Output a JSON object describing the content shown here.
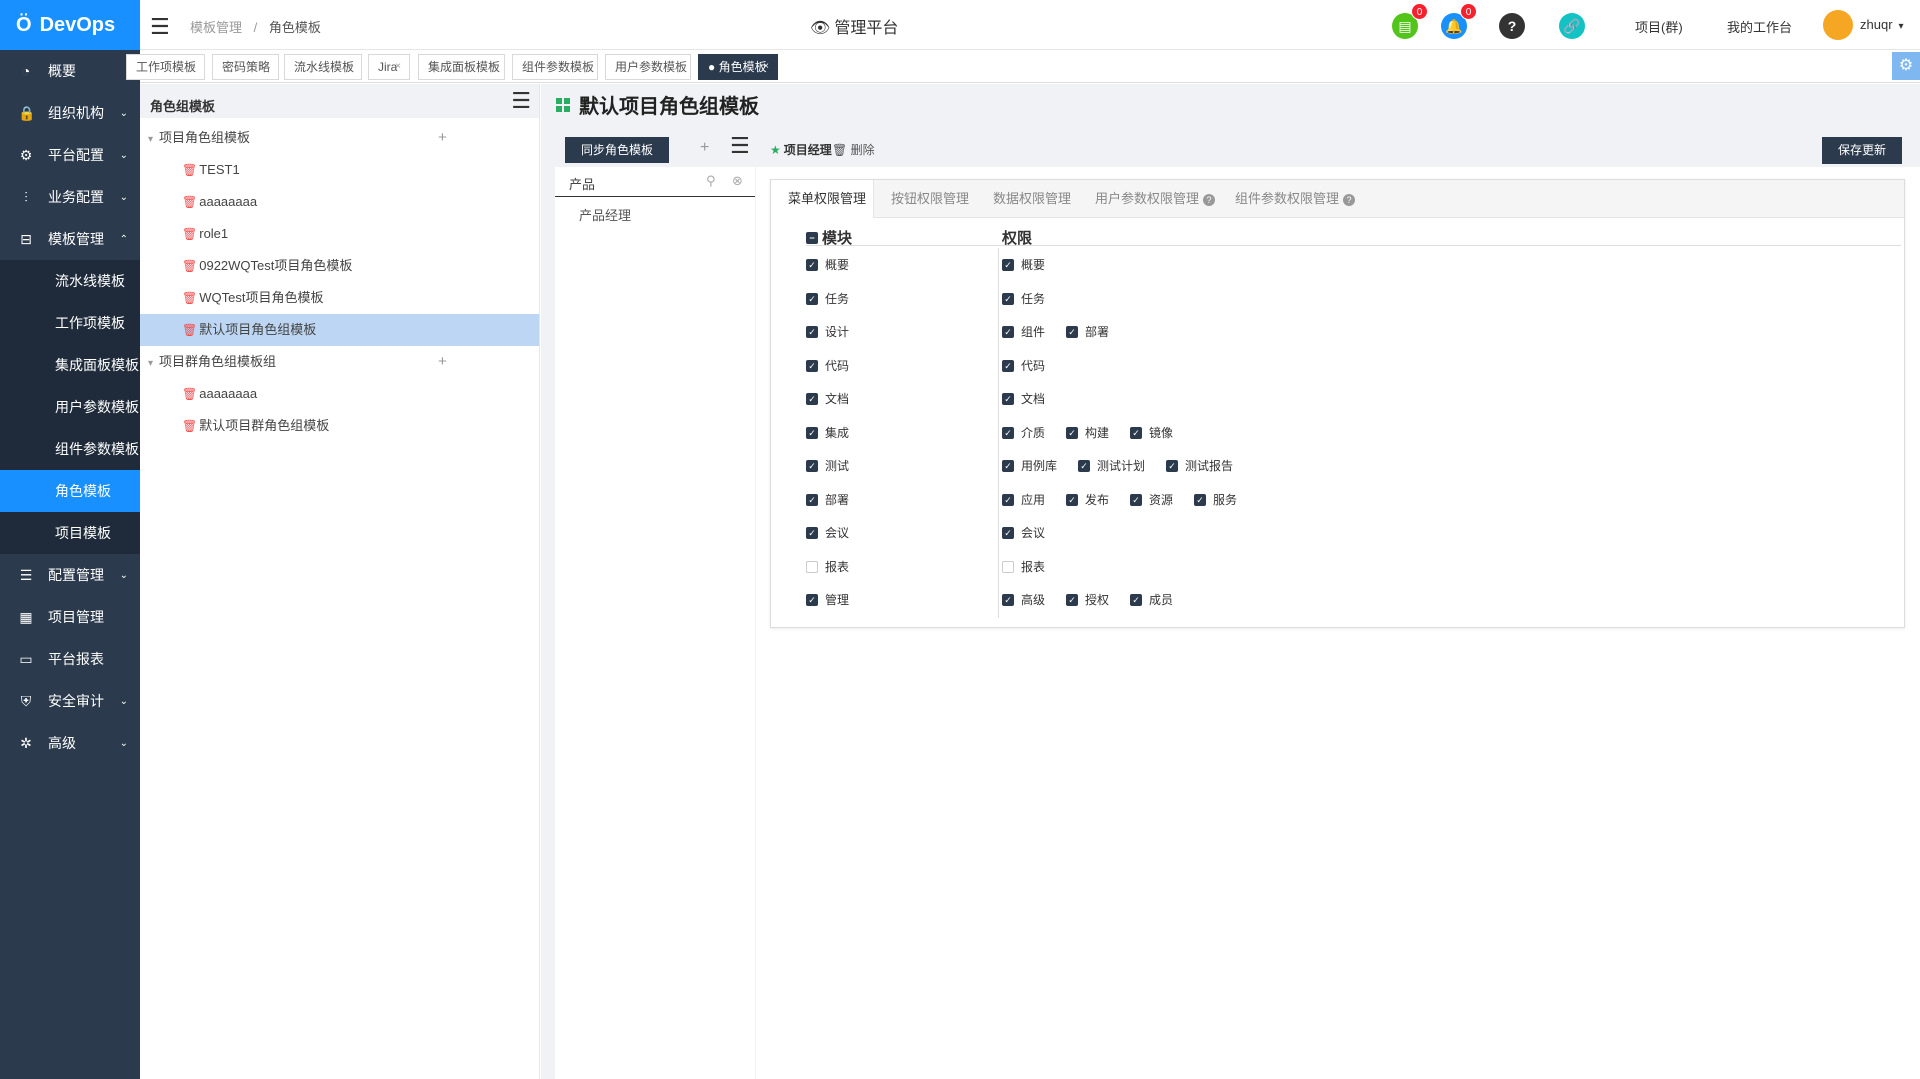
{
  "app": {
    "logo_text": "DevOps",
    "brand_color": "#1890ff",
    "sidebar_color": "#2b3a4d"
  },
  "sidebar": {
    "items": [
      {
        "label": "概要",
        "icon": "dashboard-icon",
        "caret": ""
      },
      {
        "label": "组织机构",
        "icon": "lock-icon",
        "caret": "⌄"
      },
      {
        "label": "平台配置",
        "icon": "gear-icon",
        "caret": "⌄"
      },
      {
        "label": "业务配置",
        "icon": "sliders-icon",
        "caret": "⌄"
      },
      {
        "label": "模板管理",
        "icon": "template-icon",
        "caret": "⌃"
      },
      {
        "label": "流水线模板",
        "sub": true
      },
      {
        "label": "工作项模板",
        "sub": true
      },
      {
        "label": "集成面板模板",
        "sub": true
      },
      {
        "label": "用户参数模板",
        "sub": true
      },
      {
        "label": "组件参数模板",
        "sub": true
      },
      {
        "label": "角色模板",
        "sub": true,
        "active": true
      },
      {
        "label": "项目模板",
        "sub": true
      },
      {
        "label": "配置管理",
        "icon": "database-icon",
        "caret": "⌄"
      },
      {
        "label": "项目管理",
        "icon": "grid-icon",
        "caret": ""
      },
      {
        "label": "平台报表",
        "icon": "monitor-icon",
        "caret": ""
      },
      {
        "label": "安全审计",
        "icon": "shield-icon",
        "caret": "⌄"
      },
      {
        "label": "高级",
        "icon": "advanced-icon",
        "caret": "⌄"
      }
    ]
  },
  "topbar": {
    "breadcrumb": {
      "parent": "模板管理",
      "sep": "/",
      "current": "角色模板"
    },
    "center_title": "管理平台",
    "task_badge": "0",
    "notify_badge": "0",
    "project_group": "项目(群)",
    "my_workspace": "我的工作台",
    "username": "zhuqr"
  },
  "tabs": [
    {
      "label": "工作项模板"
    },
    {
      "label": "密码策略"
    },
    {
      "label": "流水线模板"
    },
    {
      "label": "Jira"
    },
    {
      "label": "集成面板模板"
    },
    {
      "label": "组件参数模板"
    },
    {
      "label": "用户参数模板"
    },
    {
      "label": "● 角色模板",
      "active": true
    }
  ],
  "tree": {
    "title": "角色组模板",
    "groups": [
      {
        "label": "项目角色组模板",
        "children": [
          "TEST1",
          "aaaaaaaa",
          "role1",
          "0922WQTest项目角色模板",
          "WQTest项目角色模板",
          "默认项目角色组模板"
        ]
      },
      {
        "label": "项目群角色组模板组",
        "children": [
          "aaaaaaaa",
          "默认项目群角色组模板"
        ]
      }
    ],
    "selected": "默认项目角色组模板"
  },
  "main": {
    "title": "默认项目角色组模板",
    "sync_button": "同步角色模板",
    "search_value": "产品",
    "roles": [
      "产品经理"
    ],
    "selected_role": "项目经理",
    "delete_label": "删除",
    "save_button": "保存更新",
    "subtabs": [
      {
        "label": "菜单权限管理",
        "active": true,
        "help": false
      },
      {
        "label": "按钮权限管理",
        "help": false
      },
      {
        "label": "数据权限管理",
        "help": false
      },
      {
        "label": "用户参数权限管理",
        "help": true
      },
      {
        "label": "组件参数权限管理",
        "help": true
      }
    ],
    "module_header": "模块",
    "permission_header": "权限",
    "rows": [
      {
        "module": "概要",
        "checked": true,
        "perms": [
          {
            "label": "概要",
            "checked": true
          }
        ]
      },
      {
        "module": "任务",
        "checked": true,
        "perms": [
          {
            "label": "任务",
            "checked": true
          }
        ]
      },
      {
        "module": "设计",
        "checked": true,
        "perms": [
          {
            "label": "组件",
            "checked": true
          },
          {
            "label": "部署",
            "checked": true
          }
        ]
      },
      {
        "module": "代码",
        "checked": true,
        "perms": [
          {
            "label": "代码",
            "checked": true
          }
        ]
      },
      {
        "module": "文档",
        "checked": true,
        "perms": [
          {
            "label": "文档",
            "checked": true
          }
        ]
      },
      {
        "module": "集成",
        "checked": true,
        "perms": [
          {
            "label": "介质",
            "checked": true
          },
          {
            "label": "构建",
            "checked": true
          },
          {
            "label": "镜像",
            "checked": true
          }
        ]
      },
      {
        "module": "测试",
        "checked": true,
        "perms": [
          {
            "label": "用例库",
            "checked": true
          },
          {
            "label": "测试计划",
            "checked": true
          },
          {
            "label": "测试报告",
            "checked": true
          }
        ]
      },
      {
        "module": "部署",
        "checked": true,
        "perms": [
          {
            "label": "应用",
            "checked": true
          },
          {
            "label": "发布",
            "checked": true
          },
          {
            "label": "资源",
            "checked": true
          },
          {
            "label": "服务",
            "checked": true
          }
        ]
      },
      {
        "module": "会议",
        "checked": true,
        "perms": [
          {
            "label": "会议",
            "checked": true
          }
        ]
      },
      {
        "module": "报表",
        "checked": false,
        "perms": [
          {
            "label": "报表",
            "checked": false
          }
        ]
      },
      {
        "module": "管理",
        "checked": true,
        "perms": [
          {
            "label": "高级",
            "checked": true
          },
          {
            "label": "授权",
            "checked": true
          },
          {
            "label": "成员",
            "checked": true
          }
        ]
      }
    ]
  }
}
